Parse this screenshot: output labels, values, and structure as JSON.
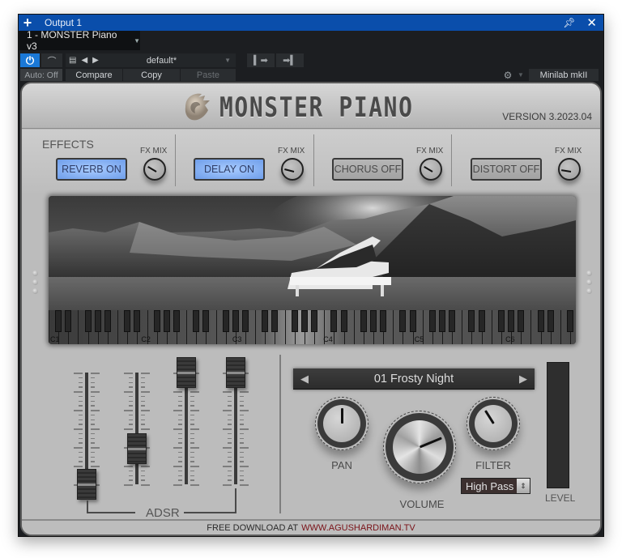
{
  "window": {
    "title": "Output 1",
    "plugin_tab": "1 - MONSTER Piano v3"
  },
  "toolbar": {
    "power_icon": "⏻",
    "automation_icon": "⌒",
    "auto_label": "Auto: Off",
    "preset_name": "default*",
    "compare_label": "Compare",
    "copy_label": "Copy",
    "paste_label": "Paste",
    "device_label": "Minilab mkII"
  },
  "plugin": {
    "brand": "MONSTER PIANO",
    "version": "VERSION 3.2023.04",
    "effects_label": "EFFECTS",
    "effects": [
      {
        "label": "REVERB ON",
        "state": "on",
        "mix_label": "FX MIX",
        "mix": 0.28
      },
      {
        "label": "DELAY ON",
        "state": "on",
        "mix_label": "FX MIX",
        "mix": 0.22
      },
      {
        "label": "CHORUS OFF",
        "state": "off",
        "mix_label": "FX MIX",
        "mix": 0.28
      },
      {
        "label": "DISTORT OFF",
        "state": "off",
        "mix_label": "FX MIX",
        "mix": 0.2
      }
    ],
    "keyboard_octaves": [
      "C1",
      "C2",
      "C3",
      "C4",
      "C5",
      "C6"
    ],
    "adsr": {
      "label": "ADSR",
      "sliders": [
        {
          "name": "attack",
          "value": 0.0
        },
        {
          "name": "decay",
          "value": 0.32
        },
        {
          "name": "sustain",
          "value": 1.0
        },
        {
          "name": "release",
          "value": 1.0
        }
      ]
    },
    "preset": {
      "name": "01 Frosty Night"
    },
    "knobs": {
      "pan": {
        "label": "PAN",
        "value": 0.5
      },
      "volume": {
        "label": "VOLUME",
        "value": 0.75
      },
      "filter": {
        "label": "FILTER",
        "value": 0.38
      }
    },
    "filter_type": "High Pass",
    "level": {
      "label": "LEVEL",
      "value": 0.0
    },
    "footer": {
      "text": "FREE DOWNLOAD AT",
      "link": "WWW.AGUSHARDIMAN.TV"
    }
  }
}
